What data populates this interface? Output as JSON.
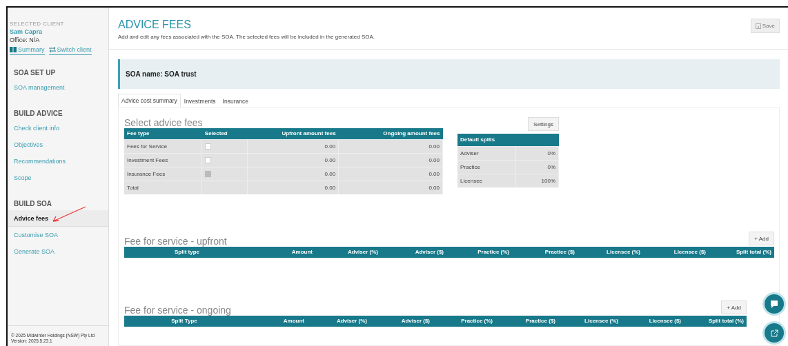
{
  "sidebar": {
    "client_heading": "SELECTED CLIENT",
    "client_name": "Sam Capra",
    "office": "Office: N/A",
    "links": [
      {
        "kind": "summary",
        "label": "Summary"
      },
      {
        "kind": "switch",
        "label": "Switch client"
      }
    ],
    "sections": [
      {
        "title": "SOA SET UP",
        "items": [
          {
            "label": "SOA management",
            "selected": false
          }
        ]
      },
      {
        "title": "BUILD ADVICE",
        "items": [
          {
            "label": "Check client info",
            "selected": false
          },
          {
            "label": "Objectives",
            "selected": false
          },
          {
            "label": "Recommendations",
            "selected": false
          },
          {
            "label": "Scope",
            "selected": false
          }
        ]
      },
      {
        "title": "BUILD SOA",
        "items": [
          {
            "label": "Advice fees",
            "selected": true
          },
          {
            "label": "Customise SOA",
            "selected": false
          },
          {
            "label": "Generate SOA",
            "selected": false
          }
        ]
      }
    ],
    "footer": [
      "© 2025 Midwinter Holdings (NSW) Pty Ltd",
      "Version: 2025.5.23.1"
    ]
  },
  "header": {
    "title": "ADVICE FEES",
    "subtitle": "Add and edit any fees associated with the SOA. The selected fees will be included in the generated SOA.",
    "save_button": {
      "label": "Save",
      "disabled": true
    }
  },
  "soa_name": "SOA name: SOA trust",
  "tabs": [
    {
      "label": "Advice cost summary",
      "selected": true
    },
    {
      "label": "Investments",
      "selected": false
    },
    {
      "label": "Insurance",
      "selected": false
    }
  ],
  "select_fees": {
    "title": "Select advice fees",
    "settings_button": "Settings",
    "columns": [
      "Fee type",
      "Selected",
      "Upfront amount fees",
      "Ongoing amount fees"
    ],
    "rows": [
      {
        "fee_type": "Fees for Service",
        "kind": "checkbox",
        "checked": false,
        "disabled": false,
        "upfront": "0.00",
        "ongoing": "0.00"
      },
      {
        "fee_type": "Investment Fees",
        "kind": "checkbox",
        "checked": false,
        "disabled": false,
        "upfront": "0.00",
        "ongoing": "0.00"
      },
      {
        "fee_type": "Insurance Fees",
        "kind": "checkbox",
        "checked": false,
        "disabled": true,
        "upfront": "0.00",
        "ongoing": "0.00"
      },
      {
        "fee_type": "Total",
        "kind": "total",
        "upfront": "0.00",
        "ongoing": "0.00"
      }
    ],
    "default_splits": {
      "title": "Default splits",
      "rows": [
        {
          "label": "Adviser",
          "value": "0%"
        },
        {
          "label": "Practice",
          "value": "0%"
        },
        {
          "label": "Licensee",
          "value": "100%"
        }
      ]
    }
  },
  "fee_sections": [
    {
      "title": "Fee for service - upfront",
      "add_button": "+ Add",
      "columns": [
        "Split type",
        "Amount",
        "Adviser (%)",
        "Adviser ($)",
        "Practice (%)",
        "Practice ($)",
        "Licensee (%)",
        "Licensee ($)",
        "Split total (%)"
      ]
    },
    {
      "title": "Fee for service - ongoing",
      "add_button": "+ Add",
      "columns": [
        "Split Type",
        "Amount",
        "Adviser (%)",
        "Adviser ($)",
        "Practice (%)",
        "Practice ($)",
        "Licensee (%)",
        "Licensee ($)",
        "Split total (%)"
      ]
    }
  ]
}
